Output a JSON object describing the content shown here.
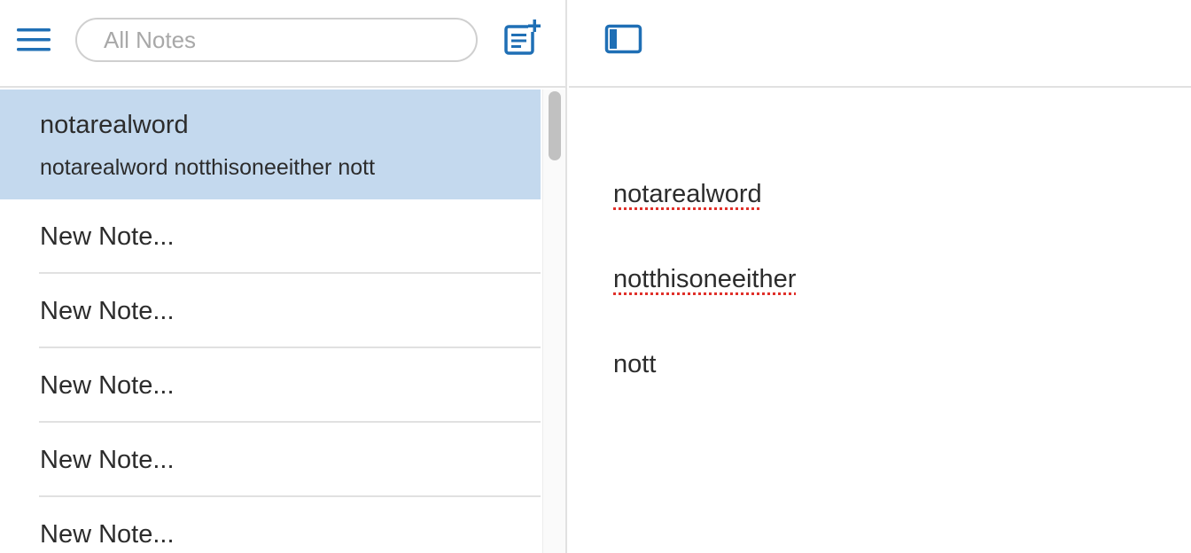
{
  "search": {
    "placeholder": "All Notes"
  },
  "toolbar": {
    "menu_icon": "hamburger-menu-icon",
    "new_note_icon": "new-note-icon",
    "sidebar_toggle_icon": "sidebar-toggle-icon"
  },
  "notes": [
    {
      "title": "notarealword",
      "preview": "notarealword notthisoneeither nott",
      "selected": true
    },
    {
      "title": "New Note..."
    },
    {
      "title": "New Note..."
    },
    {
      "title": "New Note..."
    },
    {
      "title": "New Note..."
    },
    {
      "title": "New Note..."
    }
  ],
  "editor": {
    "lines": [
      "notarealword",
      "notthisoneeither",
      "nott"
    ]
  },
  "colors": {
    "accent": "#1f6fb5",
    "selected_row": "#c4d9ee",
    "spellcheck_underline": "#e0302a"
  }
}
